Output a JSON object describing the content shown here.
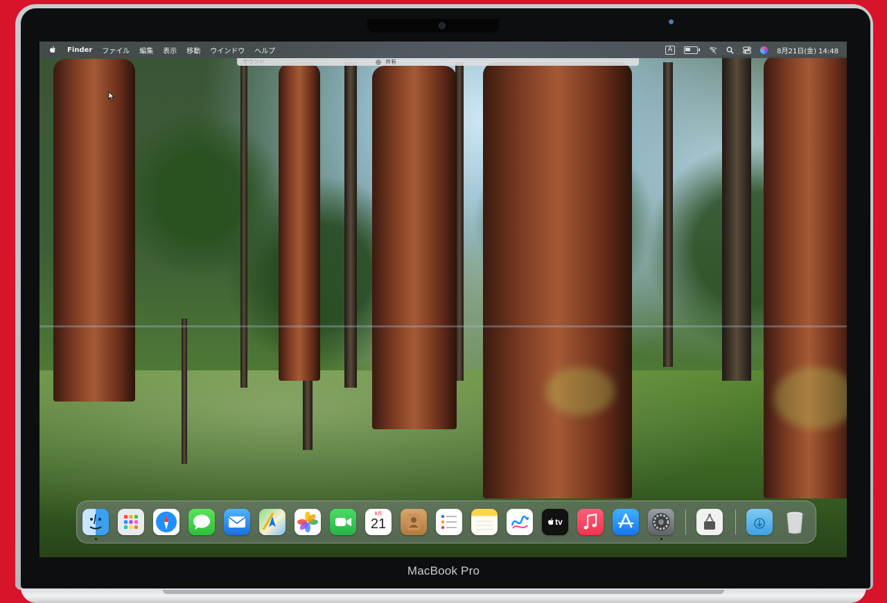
{
  "menubar": {
    "app_name": "Finder",
    "items": [
      "ファイル",
      "編集",
      "表示",
      "移動",
      "ウインドウ",
      "ヘルプ"
    ],
    "input_mode": "A",
    "datetime": "8月21日(金)  14:48"
  },
  "finder_strip": {
    "left_label": "サウンド",
    "share_label": "共有"
  },
  "laptop": {
    "model_label": "MacBook Pro"
  },
  "dock": {
    "apps": [
      {
        "name": "Finder",
        "icon": "finder-icon",
        "running": true
      },
      {
        "name": "Launchpad",
        "icon": "launchpad-icon",
        "running": false
      },
      {
        "name": "Safari",
        "icon": "safari-icon",
        "running": false
      },
      {
        "name": "Messages",
        "icon": "messages-icon",
        "running": false
      },
      {
        "name": "Mail",
        "icon": "mail-icon",
        "running": false
      },
      {
        "name": "Maps",
        "icon": "maps-icon",
        "running": false
      },
      {
        "name": "Photos",
        "icon": "photos-icon",
        "running": false
      },
      {
        "name": "FaceTime",
        "icon": "facetime-icon",
        "running": false
      },
      {
        "name": "Calendar",
        "icon": "calendar-icon",
        "running": false
      },
      {
        "name": "Contacts",
        "icon": "contacts-icon",
        "running": false
      },
      {
        "name": "Reminders",
        "icon": "reminders-icon",
        "running": false
      },
      {
        "name": "Notes",
        "icon": "notes-icon",
        "running": false
      },
      {
        "name": "Freeform",
        "icon": "freeform-icon",
        "running": false
      },
      {
        "name": "TV",
        "icon": "tv-icon",
        "running": false
      },
      {
        "name": "Music",
        "icon": "music-icon",
        "running": false
      },
      {
        "name": "App Store",
        "icon": "appstore-icon",
        "running": false
      },
      {
        "name": "System Settings",
        "icon": "settings-icon",
        "running": true
      },
      {
        "name": "Utility",
        "icon": "utility-icon",
        "running": false
      },
      {
        "name": "Downloads",
        "icon": "downloads-folder-icon",
        "running": false
      },
      {
        "name": "Trash",
        "icon": "trash-icon",
        "running": false
      }
    ],
    "calendar": {
      "month": "8月",
      "day": "21"
    },
    "tv_label": "tv"
  }
}
